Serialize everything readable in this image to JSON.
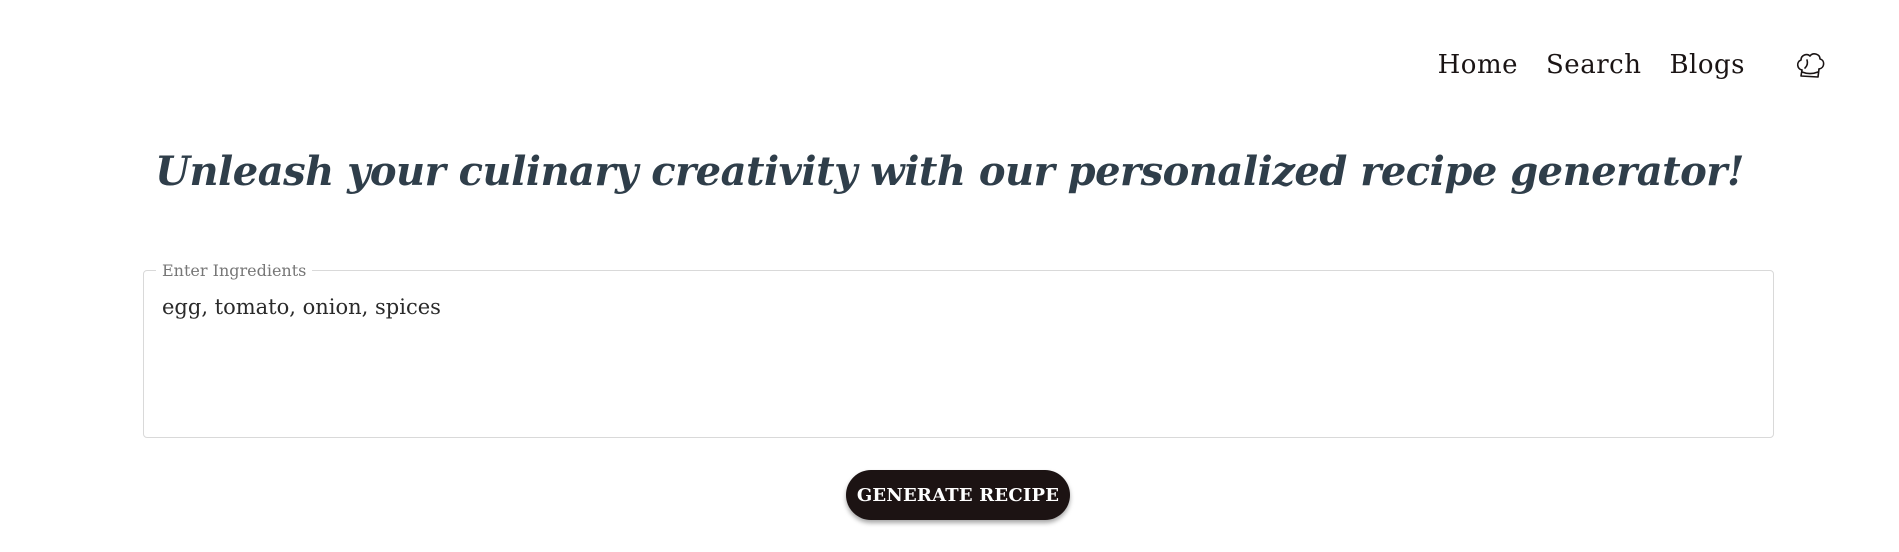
{
  "nav": {
    "items": [
      {
        "label": "Home"
      },
      {
        "label": "Search"
      },
      {
        "label": "Blogs"
      }
    ],
    "icon": "chef-hat-icon"
  },
  "hero": {
    "title": "Unleash your culinary creativity with our personalized recipe generator!"
  },
  "ingredients": {
    "label": "Enter Ingredients",
    "value": "egg, tomato, onion, spices"
  },
  "actions": {
    "generate_label": "GENERATE RECIPE"
  },
  "colors": {
    "title": "#2f3e4a",
    "button_bg": "#1c1313",
    "button_text": "#ffffff",
    "border": "#d9d9d9"
  }
}
